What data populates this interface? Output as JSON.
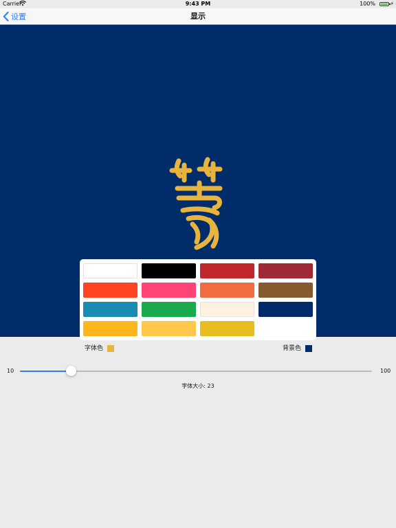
{
  "status_bar": {
    "carrier": "Carrier",
    "time": "9:43 PM",
    "battery": "100%"
  },
  "nav": {
    "back_label": "设置",
    "title": "显示"
  },
  "preview": {
    "background_color": "#002d69",
    "character_color": "#e8b43d"
  },
  "palette": {
    "colors": [
      "#ffffff",
      "#000000",
      "#c1272d",
      "#9e2b35",
      "#ff4422",
      "#fe4477",
      "#f26c3f",
      "#86592e",
      "#1a8bb3",
      "#1baa4e",
      "#fdf1df",
      "#002d69",
      "#ffb71b",
      "#ffc84a",
      "#e8bd20"
    ]
  },
  "font_color": {
    "label": "字体色",
    "value": "#e8b43d"
  },
  "bg_color": {
    "label": "背景色",
    "value": "#002d69"
  },
  "slider": {
    "min_label": "10",
    "max_label": "100",
    "min": 10,
    "max": 100,
    "value": 23
  },
  "size_readout": "字体大小: 23"
}
